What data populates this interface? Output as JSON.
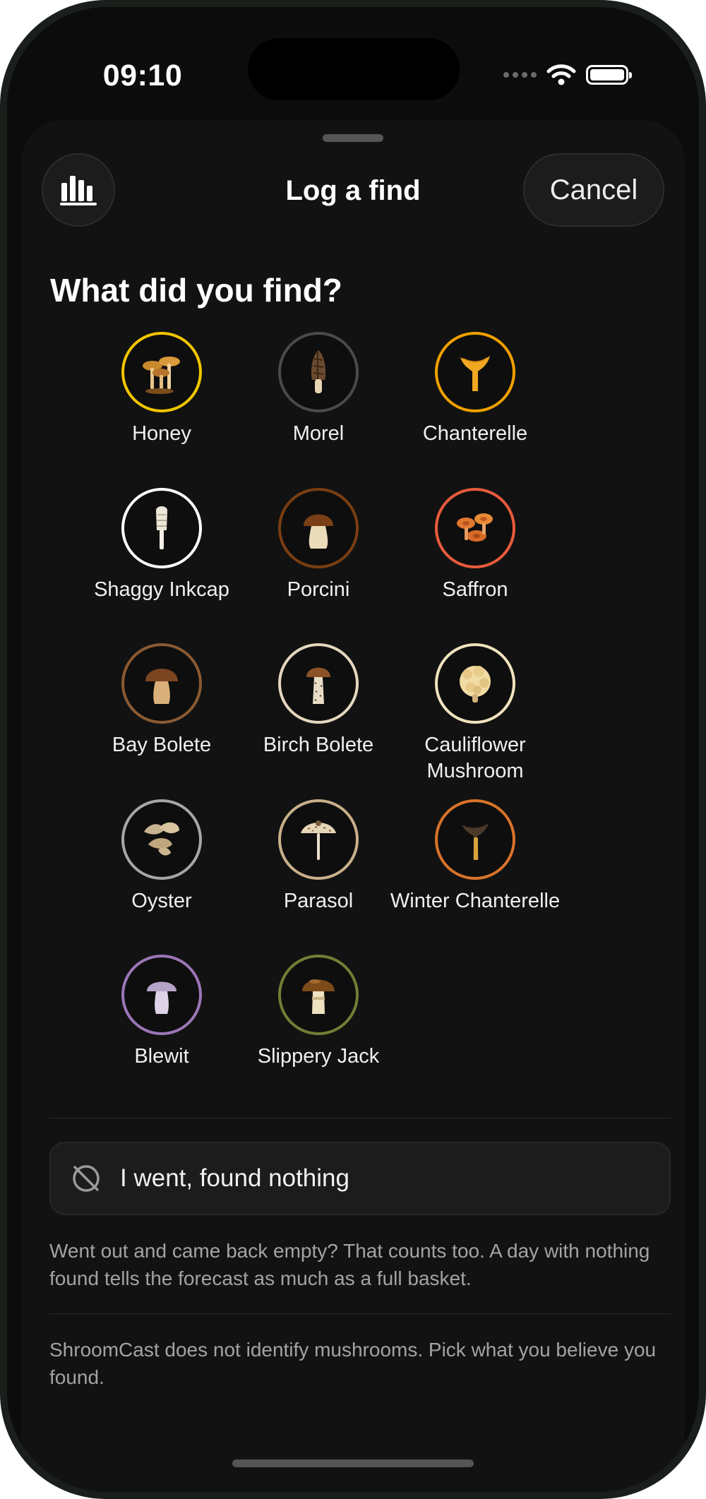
{
  "status": {
    "time": "09:10"
  },
  "header": {
    "title": "Log a find",
    "cancel_label": "Cancel",
    "stats_icon": "bar-chart-icon"
  },
  "question": "What did you find?",
  "species": [
    {
      "label": "Honey",
      "ring_color": "#f2c500",
      "icon": "honey-mushroom-icon"
    },
    {
      "label": "Morel",
      "ring_color": "#4a4a4a",
      "icon": "morel-icon"
    },
    {
      "label": "Chanterelle",
      "ring_color": "#f0a000",
      "icon": "chanterelle-icon"
    },
    {
      "label": "Shaggy Inkcap",
      "ring_color": "#ffffff",
      "icon": "shaggy-inkcap-icon"
    },
    {
      "label": "Porcini",
      "ring_color": "#7a3e12",
      "icon": "porcini-icon"
    },
    {
      "label": "Saffron",
      "ring_color": "#e85b3c",
      "icon": "saffron-milkcap-icon"
    },
    {
      "label": "Bay Bolete",
      "ring_color": "#8a5a32",
      "icon": "bay-bolete-icon"
    },
    {
      "label": "Birch Bolete",
      "ring_color": "#e4d7be",
      "icon": "birch-bolete-icon"
    },
    {
      "label": "Cauliflower Mushroom",
      "ring_color": "#f1e3be",
      "icon": "cauliflower-mushroom-icon"
    },
    {
      "label": "Oyster",
      "ring_color": "#a6a6a6",
      "icon": "oyster-mushroom-icon"
    },
    {
      "label": "Parasol",
      "ring_color": "#c9b08a",
      "icon": "parasol-icon"
    },
    {
      "label": "Winter Chanterelle",
      "ring_color": "#d9732a",
      "icon": "winter-chanterelle-icon"
    },
    {
      "label": "Blewit",
      "ring_color": "#9b76b6",
      "icon": "blewit-icon"
    },
    {
      "label": "Slippery Jack",
      "ring_color": "#6f7f35",
      "icon": "slippery-jack-icon"
    }
  ],
  "nothing": {
    "label": "I went, found nothing",
    "icon": "nothing-found-icon"
  },
  "nothing_hint": "Went out and came back empty? That counts too. A day with nothing found tells the forecast as much as a full basket.",
  "disclaimer": "ShroomCast does not identify mushrooms. Pick what you believe you found."
}
